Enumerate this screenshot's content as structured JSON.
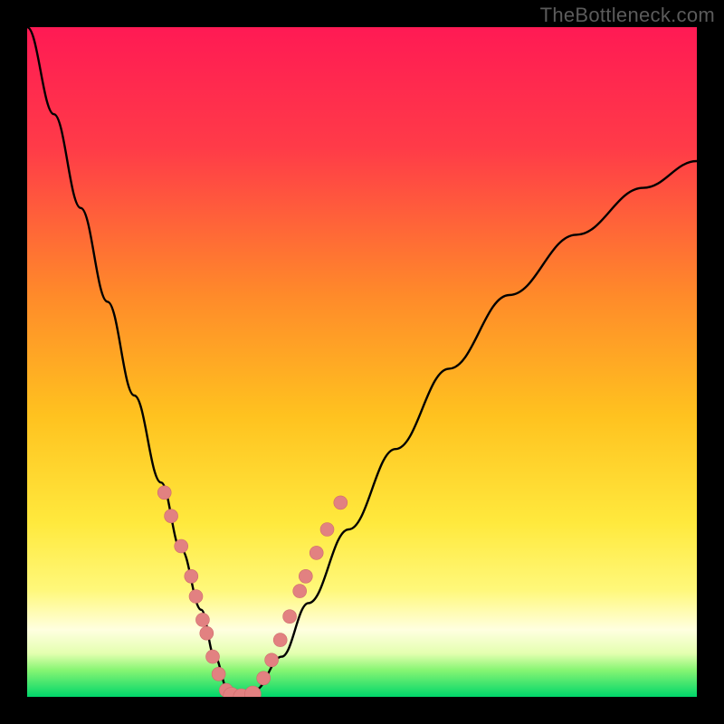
{
  "watermark": "TheBottleneck.com",
  "colors": {
    "black": "#000000",
    "curve": "#000000",
    "dot_fill": "#e28181",
    "dot_stroke": "#cf6c6c",
    "gradient_stops": [
      {
        "offset": 0,
        "color": "#ff1a54"
      },
      {
        "offset": 0.18,
        "color": "#ff3b48"
      },
      {
        "offset": 0.4,
        "color": "#ff8a2a"
      },
      {
        "offset": 0.58,
        "color": "#ffc21f"
      },
      {
        "offset": 0.74,
        "color": "#ffe93d"
      },
      {
        "offset": 0.84,
        "color": "#fff87a"
      },
      {
        "offset": 0.9,
        "color": "#ffffe0"
      },
      {
        "offset": 0.935,
        "color": "#e4ffb0"
      },
      {
        "offset": 0.96,
        "color": "#87f573"
      },
      {
        "offset": 1.0,
        "color": "#00d66a"
      }
    ]
  },
  "chart_data": {
    "type": "line",
    "title": "",
    "xlabel": "",
    "ylabel": "",
    "xlim": [
      0,
      1
    ],
    "ylim": [
      0,
      1
    ],
    "series": [
      {
        "name": "bottleneck-curve",
        "x": [
          0.0,
          0.04,
          0.08,
          0.12,
          0.16,
          0.2,
          0.23,
          0.26,
          0.28,
          0.3,
          0.32,
          0.34,
          0.38,
          0.42,
          0.48,
          0.55,
          0.63,
          0.72,
          0.82,
          0.92,
          1.0
        ],
        "y": [
          1.0,
          0.87,
          0.73,
          0.59,
          0.45,
          0.32,
          0.22,
          0.13,
          0.06,
          0.01,
          0.0,
          0.01,
          0.06,
          0.14,
          0.25,
          0.37,
          0.49,
          0.6,
          0.69,
          0.76,
          0.8
        ]
      }
    ],
    "dots_left": [
      {
        "x": 0.205,
        "y": 0.305
      },
      {
        "x": 0.215,
        "y": 0.27
      },
      {
        "x": 0.23,
        "y": 0.225
      },
      {
        "x": 0.245,
        "y": 0.18
      },
      {
        "x": 0.252,
        "y": 0.15
      },
      {
        "x": 0.262,
        "y": 0.115
      },
      {
        "x": 0.268,
        "y": 0.095
      },
      {
        "x": 0.277,
        "y": 0.06
      },
      {
        "x": 0.286,
        "y": 0.034
      },
      {
        "x": 0.297,
        "y": 0.01
      }
    ],
    "dots_bottom": [
      {
        "x": 0.305,
        "y": 0.002
      },
      {
        "x": 0.32,
        "y": 0.0
      },
      {
        "x": 0.337,
        "y": 0.004
      }
    ],
    "dots_right": [
      {
        "x": 0.353,
        "y": 0.028
      },
      {
        "x": 0.365,
        "y": 0.055
      },
      {
        "x": 0.378,
        "y": 0.085
      },
      {
        "x": 0.392,
        "y": 0.12
      },
      {
        "x": 0.407,
        "y": 0.158
      },
      {
        "x": 0.416,
        "y": 0.18
      },
      {
        "x": 0.432,
        "y": 0.215
      },
      {
        "x": 0.448,
        "y": 0.25
      },
      {
        "x": 0.468,
        "y": 0.29
      }
    ]
  }
}
